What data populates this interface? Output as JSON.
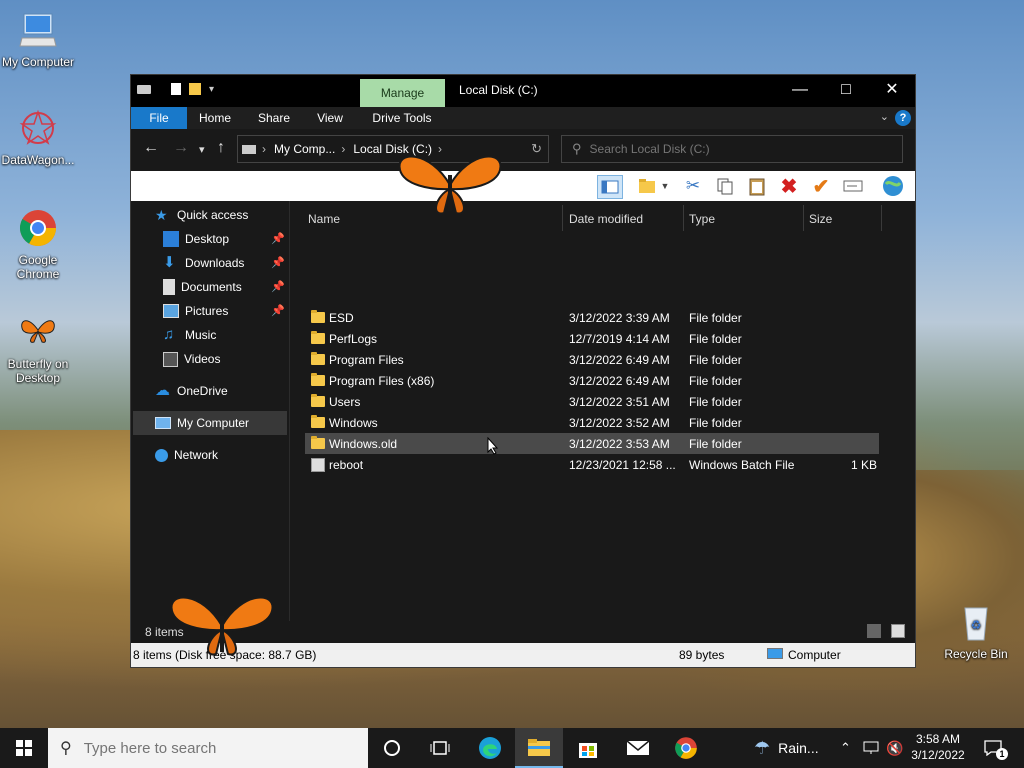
{
  "desktop": {
    "icons": [
      {
        "label": "My Computer"
      },
      {
        "label": "DataWagon..."
      },
      {
        "label": "Google Chrome"
      },
      {
        "label": "Butterfly on Desktop"
      },
      {
        "label": "Recycle Bin"
      }
    ]
  },
  "window": {
    "title": "Local Disk (C:)",
    "manage_tab": "Manage",
    "ribbon_tabs": [
      "File",
      "Home",
      "Share",
      "View",
      "Drive Tools"
    ],
    "address": {
      "segments": [
        "My Comp...",
        "Local Disk (C:)"
      ]
    },
    "search": {
      "placeholder": "Search Local Disk (C:)"
    },
    "nav": {
      "quick_access": "Quick access",
      "items": [
        {
          "label": "Desktop"
        },
        {
          "label": "Downloads"
        },
        {
          "label": "Documents"
        },
        {
          "label": "Pictures"
        },
        {
          "label": "Music"
        },
        {
          "label": "Videos"
        }
      ],
      "onedrive": "OneDrive",
      "my_computer": "My Computer",
      "network": "Network"
    },
    "columns": {
      "name": "Name",
      "date": "Date modified",
      "type": "Type",
      "size": "Size"
    },
    "files": [
      {
        "name": "ESD",
        "date": "3/12/2022 3:39 AM",
        "type": "File folder",
        "size": ""
      },
      {
        "name": "PerfLogs",
        "date": "12/7/2019 4:14 AM",
        "type": "File folder",
        "size": ""
      },
      {
        "name": "Program Files",
        "date": "3/12/2022 6:49 AM",
        "type": "File folder",
        "size": ""
      },
      {
        "name": "Program Files (x86)",
        "date": "3/12/2022 6:49 AM",
        "type": "File folder",
        "size": ""
      },
      {
        "name": "Users",
        "date": "3/12/2022 3:51 AM",
        "type": "File folder",
        "size": ""
      },
      {
        "name": "Windows",
        "date": "3/12/2022 3:52 AM",
        "type": "File folder",
        "size": ""
      },
      {
        "name": "Windows.old",
        "date": "3/12/2022 3:53 AM",
        "type": "File folder",
        "size": ""
      },
      {
        "name": "reboot",
        "date": "12/23/2021 12:58 ...",
        "type": "Windows Batch File",
        "size": "1 KB"
      }
    ],
    "status_items": "8 items",
    "footer": {
      "left": "8 items (Disk free space: 88.7 GB)",
      "middle": "89 bytes",
      "right": "Computer"
    }
  },
  "taskbar": {
    "search_placeholder": "Type here to search",
    "weather": "Rain...",
    "time": "3:58 AM",
    "date": "3/12/2022"
  }
}
